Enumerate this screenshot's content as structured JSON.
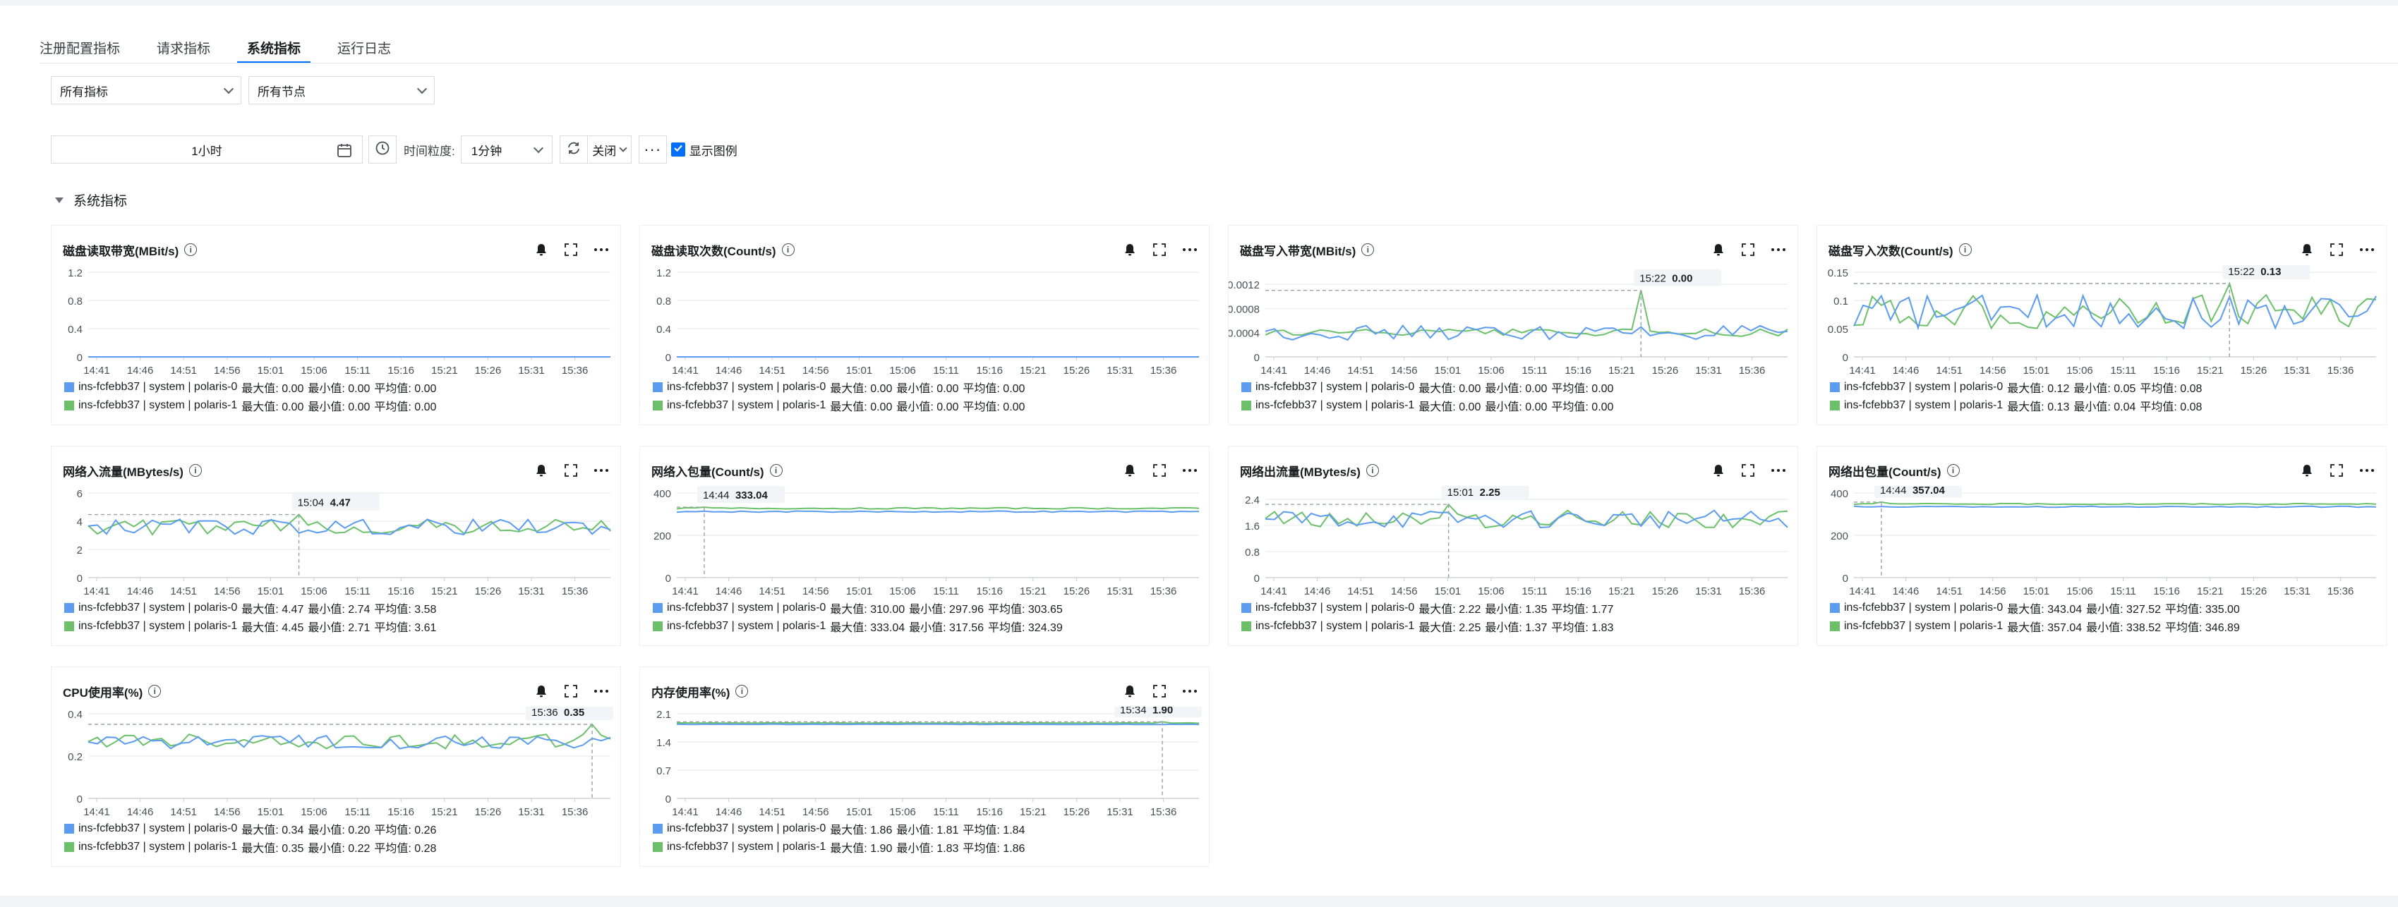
{
  "tabs": [
    "注册配置指标",
    "请求指标",
    "系统指标",
    "运行日志"
  ],
  "active_tab": 2,
  "filters": {
    "metrics": "所有指标",
    "nodes": "所有节点"
  },
  "toolbar": {
    "time_range": "1小时",
    "granularity_label": "时间粒度:",
    "granularity": "1分钟",
    "refresh": "关闭",
    "more": "···",
    "show_legend": "显示图例"
  },
  "section_title": "系统指标",
  "colors": {
    "series0": "#5b9bf0",
    "series1": "#6cc06a",
    "grid": "#e9ebee",
    "accent": "#006eff"
  },
  "icons": [
    "bell-icon",
    "fullscreen-icon",
    "more-icon",
    "info-icon",
    "calendar-icon",
    "clock-icon",
    "refresh-icon",
    "chevron-down-icon",
    "check-icon"
  ],
  "x_ticks": [
    "14:41",
    "14:46",
    "14:51",
    "14:56",
    "15:01",
    "15:06",
    "15:11",
    "15:16",
    "15:21",
    "15:26",
    "15:31",
    "15:36"
  ],
  "panels": [
    {
      "title": "磁盘读取带宽(MBit/s)",
      "ylim": [
        0,
        1.2
      ],
      "yticks": [
        "1.2",
        "0.8",
        "0.4",
        "0"
      ],
      "kind": "flat",
      "base": 0,
      "amp": 0,
      "legend": [
        {
          "name": "ins-fcfebb37 | system | polaris-0",
          "max": "0.00",
          "min": "0.00",
          "avg": "0.00"
        },
        {
          "name": "ins-fcfebb37 | system | polaris-1",
          "max": "0.00",
          "min": "0.00",
          "avg": "0.00"
        }
      ]
    },
    {
      "title": "磁盘读取次数(Count/s)",
      "ylim": [
        0,
        1.2
      ],
      "yticks": [
        "1.2",
        "0.8",
        "0.4",
        "0"
      ],
      "kind": "flat",
      "base": 0,
      "amp": 0,
      "legend": [
        {
          "name": "ins-fcfebb37 | system | polaris-0",
          "max": "0.00",
          "min": "0.00",
          "avg": "0.00"
        },
        {
          "name": "ins-fcfebb37 | system | polaris-1",
          "max": "0.00",
          "min": "0.00",
          "avg": "0.00"
        }
      ]
    },
    {
      "title": "磁盘写入带宽(MBit/s)",
      "ylim": [
        0,
        0.0014
      ],
      "yticks": [
        "0.0012",
        "0.0008",
        "0.0004",
        "0"
      ],
      "kind": "spike",
      "base": 0.0004,
      "amp": 0.00012,
      "tooltip": {
        "time": "15:22",
        "value": "0.00",
        "y": 0.0011,
        "idx": 41
      },
      "legend": [
        {
          "name": "ins-fcfebb37 | system | polaris-0",
          "max": "0.00",
          "min": "0.00",
          "avg": "0.00"
        },
        {
          "name": "ins-fcfebb37 | system | polaris-1",
          "max": "0.00",
          "min": "0.00",
          "avg": "0.00"
        }
      ]
    },
    {
      "title": "磁盘写入次数(Count/s)",
      "ylim": [
        0,
        0.15
      ],
      "yticks": [
        "0.15",
        "0.1",
        "0.05",
        "0"
      ],
      "kind": "noisy",
      "base": 0.08,
      "amp": 0.03,
      "tooltip": {
        "time": "15:22",
        "value": "0.13",
        "y": 0.13,
        "idx": 41
      },
      "legend": [
        {
          "name": "ins-fcfebb37 | system | polaris-0",
          "max": "0.12",
          "min": "0.05",
          "avg": "0.08"
        },
        {
          "name": "ins-fcfebb37 | system | polaris-1",
          "max": "0.13",
          "min": "0.04",
          "avg": "0.08"
        }
      ]
    },
    {
      "title": "网络入流量(MBytes/s)",
      "ylim": [
        0,
        6
      ],
      "yticks": [
        "6",
        "4",
        "2",
        "0"
      ],
      "kind": "noisy",
      "base": 3.6,
      "amp": 0.55,
      "tooltip": {
        "time": "15:04",
        "value": "4.47",
        "y": 4.47,
        "idx": 23
      },
      "legend": [
        {
          "name": "ins-fcfebb37 | system | polaris-0",
          "max": "4.47",
          "min": "2.74",
          "avg": "3.58"
        },
        {
          "name": "ins-fcfebb37 | system | polaris-1",
          "max": "4.45",
          "min": "2.71",
          "avg": "3.61"
        }
      ]
    },
    {
      "title": "网络入包量(Count/s)",
      "ylim": [
        0,
        400
      ],
      "yticks": [
        "400",
        "200",
        "0"
      ],
      "kind": "steady",
      "base": 318,
      "amp": 6,
      "tooltip": {
        "time": "14:44",
        "value": "333.04",
        "y": 333,
        "idx": 3
      },
      "legend": [
        {
          "name": "ins-fcfebb37 | system | polaris-0",
          "max": "310.00",
          "min": "297.96",
          "avg": "303.65"
        },
        {
          "name": "ins-fcfebb37 | system | polaris-1",
          "max": "333.04",
          "min": "317.56",
          "avg": "324.39"
        }
      ]
    },
    {
      "title": "网络出流量(MBytes/s)",
      "ylim": [
        0,
        2.6
      ],
      "yticks": [
        "2.4",
        "1.6",
        "0.8",
        "0"
      ],
      "kind": "noisy",
      "base": 1.8,
      "amp": 0.28,
      "tooltip": {
        "time": "15:01",
        "value": "2.25",
        "y": 2.25,
        "idx": 20
      },
      "legend": [
        {
          "name": "ins-fcfebb37 | system | polaris-0",
          "max": "2.22",
          "min": "1.35",
          "avg": "1.77"
        },
        {
          "name": "ins-fcfebb37 | system | polaris-1",
          "max": "2.25",
          "min": "1.37",
          "avg": "1.83"
        }
      ]
    },
    {
      "title": "网络出包量(Count/s)",
      "ylim": [
        0,
        400
      ],
      "yticks": [
        "400",
        "200",
        "0"
      ],
      "kind": "steady",
      "base": 340,
      "amp": 5,
      "tooltip": {
        "time": "14:44",
        "value": "357.04",
        "y": 357,
        "idx": 3
      },
      "legend": [
        {
          "name": "ins-fcfebb37 | system | polaris-0",
          "max": "343.04",
          "min": "327.52",
          "avg": "335.00"
        },
        {
          "name": "ins-fcfebb37 | system | polaris-1",
          "max": "357.04",
          "min": "338.52",
          "avg": "346.89"
        }
      ]
    },
    {
      "title": "CPU使用率(%)",
      "ylim": [
        0,
        0.4
      ],
      "yticks": [
        "0.4",
        "0.2",
        "0"
      ],
      "kind": "noisy",
      "base": 0.27,
      "amp": 0.035,
      "tooltip": {
        "time": "15:36",
        "value": "0.35",
        "y": 0.35,
        "idx": 55
      },
      "legend": [
        {
          "name": "ins-fcfebb37 | system | polaris-0",
          "max": "0.34",
          "min": "0.20",
          "avg": "0.26"
        },
        {
          "name": "ins-fcfebb37 | system | polaris-1",
          "max": "0.35",
          "min": "0.22",
          "avg": "0.28"
        }
      ]
    },
    {
      "title": "内存使用率(%)",
      "ylim": [
        0,
        2.1
      ],
      "yticks": [
        "2.1",
        "1.4",
        "0.7",
        "0"
      ],
      "kind": "steady",
      "base": 1.85,
      "amp": 0.012,
      "tooltip": {
        "time": "15:34",
        "value": "1.90",
        "y": 1.9,
        "idx": 53
      },
      "legend": [
        {
          "name": "ins-fcfebb37 | system | polaris-0",
          "max": "1.86",
          "min": "1.81",
          "avg": "1.84"
        },
        {
          "name": "ins-fcfebb37 | system | polaris-1",
          "max": "1.90",
          "min": "1.83",
          "avg": "1.86"
        }
      ]
    }
  ]
}
